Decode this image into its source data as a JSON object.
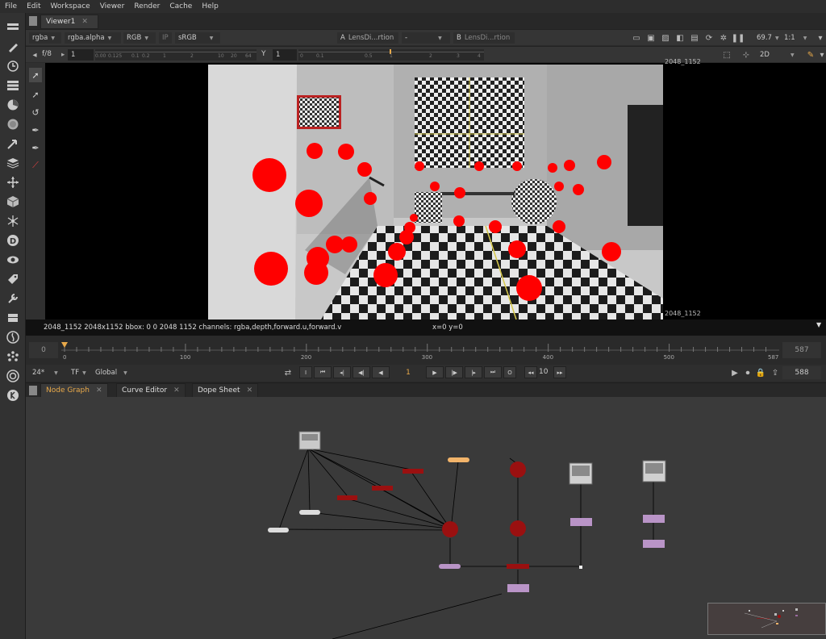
{
  "menu": [
    "File",
    "Edit",
    "Workspace",
    "Viewer",
    "Render",
    "Cache",
    "Help"
  ],
  "viewer_tab": {
    "label": "Viewer1",
    "close": "✕"
  },
  "row1": {
    "channels": "rgba",
    "alpha": "rgba.alpha",
    "display": "RGB",
    "ip": "IP",
    "lut": "sRGB",
    "a_label": "A",
    "a_input": "LensDi...rtion",
    "wipe": "-",
    "b_label": "B",
    "b_input": "LensDi...rtion",
    "zoom": "69.7",
    "ratio": "1:1"
  },
  "row2": {
    "fstop": "f/8",
    "gain": "1",
    "gain_ticks": [
      "0.00",
      "0.125",
      "0.1",
      "0.2",
      "1",
      "2",
      "10",
      "20",
      "64"
    ],
    "y_label": "Y",
    "gamma": "1",
    "gamma_ticks": [
      "0",
      "0.1",
      "0.5",
      "1",
      "2",
      "3",
      "4"
    ],
    "view_mode": "2D"
  },
  "viewport": {
    "format_top": "2048_1152",
    "format_bottom": "2048_1152"
  },
  "info_bar": {
    "text": "2048_1152 2048x1152  bbox: 0 0 2048 1152 channels: rgba,depth,forward.u,forward.v",
    "coords": "x=0 y=0"
  },
  "timeline": {
    "start": "0",
    "first": "0",
    "labels": [
      "100",
      "200",
      "300",
      "400",
      "500"
    ],
    "last_tick": "587",
    "end": "587",
    "current_frame": 0,
    "total_frames": 587
  },
  "playback": {
    "fps": "24*",
    "tf": "TF",
    "scope": "Global",
    "frame": "1",
    "in_btn": "I",
    "out_btn": "O",
    "increment": "10",
    "end_frame": "588"
  },
  "panel_tabs": [
    {
      "label": "Node Graph",
      "active": true
    },
    {
      "label": "Curve Editor",
      "active": false
    },
    {
      "label": "Dope Sheet",
      "active": false
    }
  ],
  "colors": {
    "accent": "#e8a94a",
    "node_red": "#9a1010",
    "node_purple": "#b994c7",
    "node_orange": "#f2b46a",
    "marker_red": "#ff0000"
  },
  "left_toolbar_icons": [
    "viewer-icon",
    "paint-icon",
    "time-icon",
    "channel-icon",
    "color-icon",
    "filter-icon",
    "keyer-icon",
    "merge-icon",
    "transform-icon",
    "3d-icon",
    "particles-icon",
    "deep-icon",
    "views-icon",
    "metadata-icon",
    "toolsets-icon",
    "other-icon",
    "furnace-icon",
    "ocula-icon",
    "cara-vr-icon",
    "kronos-icon"
  ]
}
